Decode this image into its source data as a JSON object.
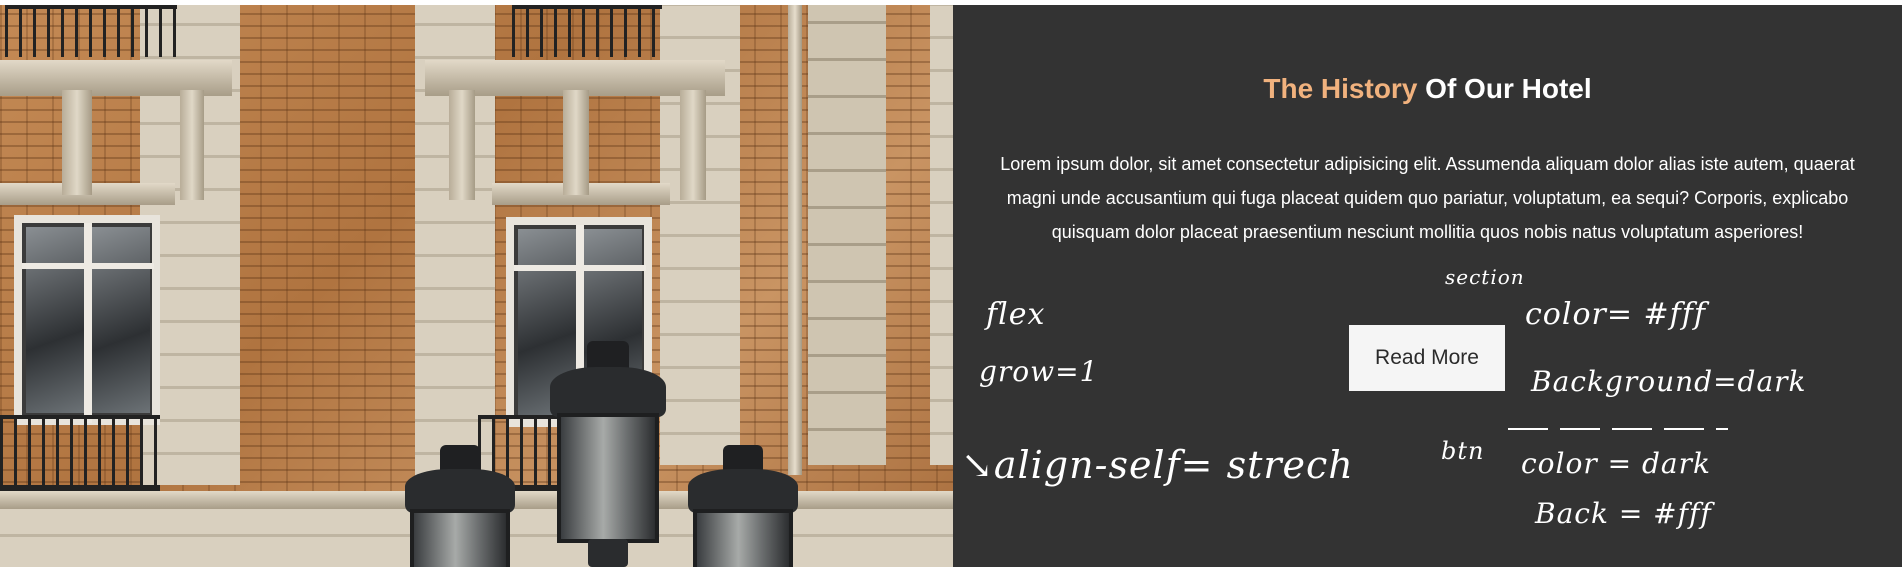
{
  "section": {
    "title_accent": "The History",
    "title_rest": "Of Our Hotel",
    "description": "Lorem ipsum dolor, sit amet consectetur adipisicing elit. Assumenda aliquam dolor alias iste autem, quaerat magni unde accusantium qui fuga placeat quidem quo pariatur, voluptatum, ea sequi? Corporis, explicabo quisquam dolor placeat praesentium nesciunt mollitia quos nobis natus voluptatum asperiores!",
    "button_label": "Read More"
  },
  "annotations": {
    "flex": "flex",
    "grow": "grow=1",
    "align_self": "↘align-self= strech",
    "section": "section",
    "color_section": "color= #fff",
    "background_section": "Background=dark",
    "btn": "btn",
    "color_btn": "color = dark",
    "back_btn": "Back = #fff"
  },
  "colors": {
    "section_background": "#333333",
    "title_accent": "#f1b27e",
    "button_background": "#f5f5f5",
    "button_text": "#2b2b2b"
  },
  "image": {
    "subject": "hotel-building-facade-photo"
  }
}
